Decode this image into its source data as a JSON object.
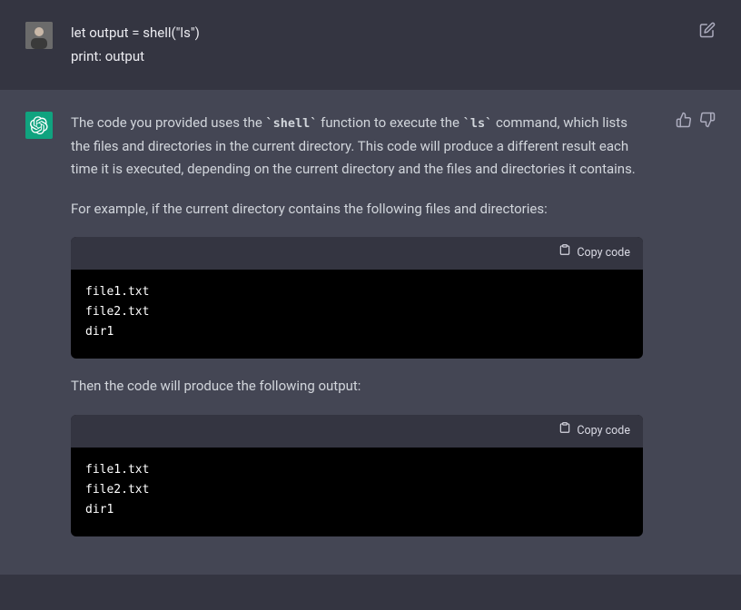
{
  "user_message": {
    "text": "let output = shell(\"ls\")\nprint: output"
  },
  "assistant_message": {
    "para1_pre": "The code you provided uses the ",
    "inline1": "`shell`",
    "para1_mid": " function to execute the ",
    "inline2": "`ls`",
    "para1_post": " command, which lists the files and directories in the current directory. This code will produce a different result each time it is executed, depending on the current directory and the files and directories it contains.",
    "para2": "For example, if the current directory contains the following files and directories:",
    "code1": "file1.txt\nfile2.txt\ndir1",
    "para3": "Then the code will produce the following output:",
    "code2": "file1.txt\nfile2.txt\ndir1"
  },
  "ui": {
    "copy_label": "Copy code"
  }
}
